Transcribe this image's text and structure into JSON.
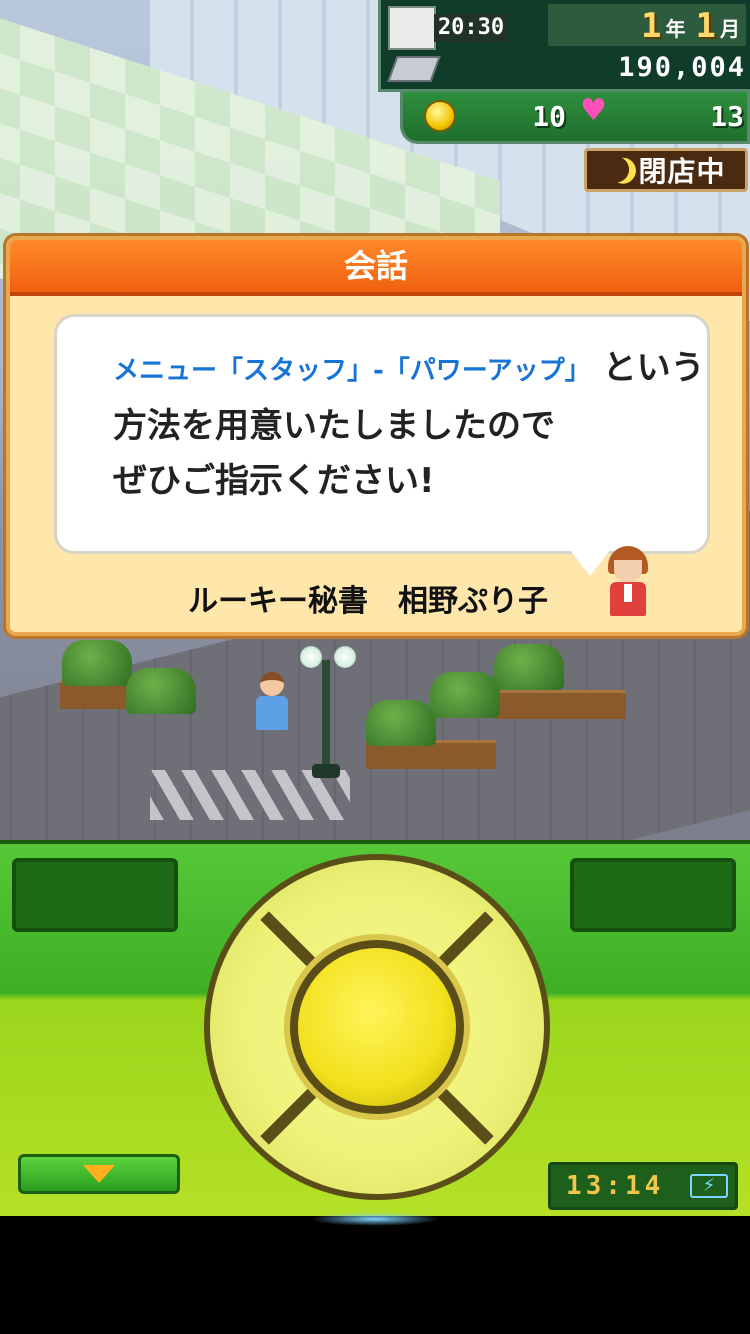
{
  "hud": {
    "time": "20:30",
    "year_num": "1",
    "year_unit": "年",
    "month_num": "1",
    "month_unit": "月",
    "money": "190,004",
    "coins": "10",
    "hearts": "13",
    "store_status": "閉店中"
  },
  "dialog": {
    "title": "会話",
    "menu_path": "メニュー「スタッフ」-「パワーアップ」",
    "line1_rest": "という",
    "line2": "方法を用意いたしましたので",
    "line3": "ぜひご指示ください!",
    "speaker": "ルーキー秘書　相野ぷり子"
  },
  "controller": {
    "clock": "13:14"
  },
  "colors": {
    "dialog_header": "#f06010",
    "dialog_bg": "#ffe7ab",
    "menu_path_text": "#1774d6",
    "controller_green": "#3fae27",
    "dpad_yellow": "#f2e01c"
  },
  "icons": [
    "calendar-icon",
    "money-icon",
    "coin-icon",
    "heart-icon",
    "moon-icon",
    "arrow-down-icon",
    "battery-icon"
  ]
}
